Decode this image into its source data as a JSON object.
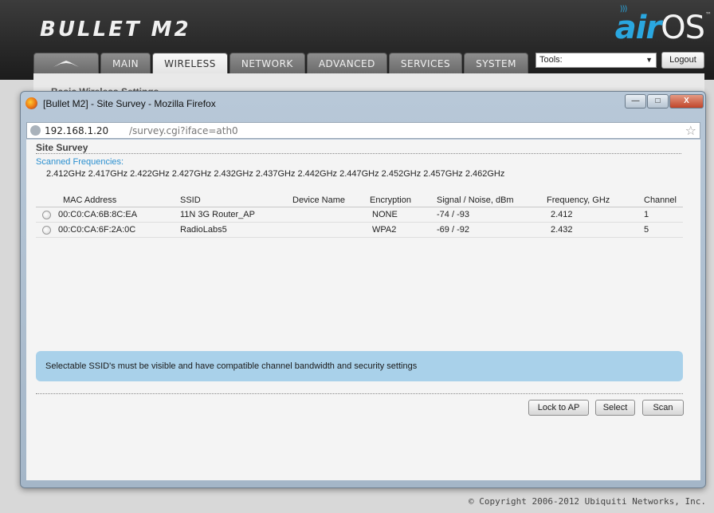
{
  "app": {
    "product_name": "BULLET M2",
    "brand_air": "air",
    "brand_os": "OS",
    "brand_tm": "™",
    "tabs": [
      {
        "label": ""
      },
      {
        "label": "MAIN"
      },
      {
        "label": "WIRELESS"
      },
      {
        "label": "NETWORK"
      },
      {
        "label": "ADVANCED"
      },
      {
        "label": "SERVICES"
      },
      {
        "label": "SYSTEM"
      }
    ],
    "active_tab": "WIRELESS",
    "tools_label": "Tools:",
    "logout_label": "Logout",
    "bg_section_title": "Basic Wireless Settings",
    "copyright": "© Copyright 2006-2012 Ubiquiti Networks, Inc."
  },
  "window": {
    "title": "[Bullet M2] - Site Survey - Mozilla Firefox",
    "url_host": "192.168.1.20",
    "url_path": "/survey.cgi?iface=ath0",
    "min_glyph": "—",
    "max_glyph": "□",
    "close_glyph": "X"
  },
  "survey": {
    "title": "Site Survey",
    "scanned_label": "Scanned Frequencies:",
    "scanned_frequencies": "2.412GHz 2.417GHz 2.422GHz 2.427GHz 2.432GHz 2.437GHz 2.442GHz 2.447GHz 2.452GHz 2.457GHz 2.462GHz",
    "columns": {
      "mac": "MAC Address",
      "ssid": "SSID",
      "device": "Device Name",
      "encryption": "Encryption",
      "signal": "Signal / Noise, dBm",
      "frequency": "Frequency, GHz",
      "channel": "Channel"
    },
    "rows": [
      {
        "mac": "00:C0:CA:6B:8C:EA",
        "ssid": "11N 3G Router_AP",
        "device": "",
        "encryption": "NONE",
        "signal": "-74 / -93",
        "frequency": "2.412",
        "channel": "1"
      },
      {
        "mac": "00:C0:CA:6F:2A:0C",
        "ssid": "RadioLabs5",
        "device": "",
        "encryption": "WPA2",
        "signal": "-69 / -92",
        "frequency": "2.432",
        "channel": "5"
      }
    ],
    "info": "Selectable SSID's must be visible and have compatible channel bandwidth and security settings",
    "buttons": {
      "lock": "Lock to AP",
      "select": "Select",
      "scan": "Scan"
    }
  },
  "colors": {
    "accent_blue": "#2aa7e0",
    "info_bg": "#a9d1ea",
    "link_blue": "#2a8fcf"
  }
}
